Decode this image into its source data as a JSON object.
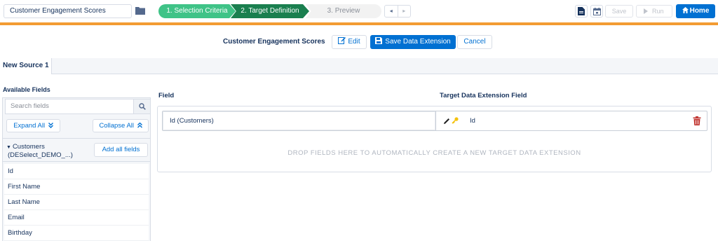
{
  "topbar": {
    "name_value": "Customer Engagement Scores",
    "steps": [
      "1. Selection Criteria",
      "2. Target Definition",
      "3. Preview"
    ],
    "prev_arrow": "◂",
    "next_arrow": "▸",
    "save_label": "Save",
    "run_label": "Run",
    "home_label": "Home"
  },
  "header": {
    "title": "Customer Engagement Scores",
    "edit_label": "Edit",
    "save_de_label": "Save Data Extension",
    "cancel_label": "Cancel"
  },
  "tabs": [
    {
      "label": "New Source 1"
    }
  ],
  "left_panel": {
    "title": "Available Fields",
    "search_placeholder": "Search fields",
    "expand_label": "Expand All",
    "collapse_label": "Collapse All",
    "source_line1": "Customers",
    "source_line2": "(DESelect_DEMO_...)",
    "add_all_label": "Add all fields",
    "fields": [
      "Id",
      "First Name",
      "Last Name",
      "Email",
      "Birthday"
    ]
  },
  "mapping": {
    "field_header": "Field",
    "target_header": "Target Data Extension Field",
    "rows": [
      {
        "source": "Id (Customers)",
        "target": "Id"
      }
    ],
    "drop_text": "DROP FIELDS HERE TO AUTOMATICALLY CREATE A NEW TARGET DATA EXTENSION"
  },
  "colors": {
    "accent_blue": "#0070d2",
    "step_done": "#3fc387",
    "step_current": "#1a7f4f",
    "orange_bar": "#f39c33",
    "delete_red": "#c23934"
  }
}
